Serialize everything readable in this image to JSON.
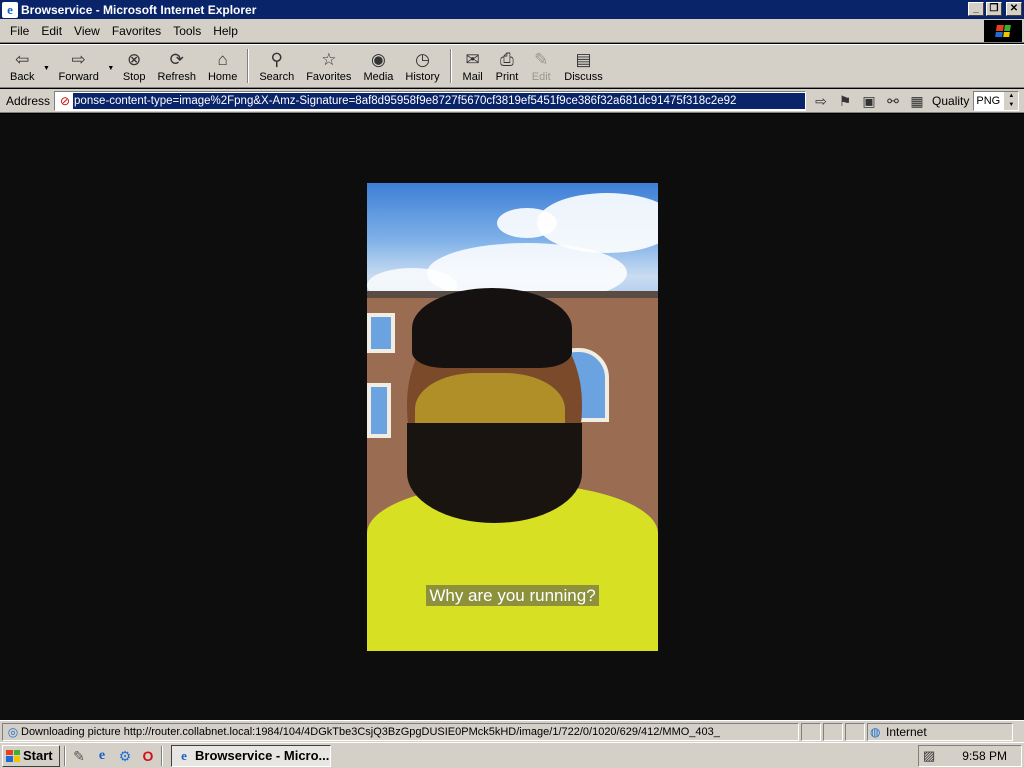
{
  "window": {
    "title": "Browservice - Microsoft Internet Explorer",
    "icon": "ie-icon",
    "controls": [
      "minimize",
      "restore",
      "close"
    ]
  },
  "menu": {
    "items": [
      "File",
      "Edit",
      "View",
      "Favorites",
      "Tools",
      "Help"
    ]
  },
  "toolbar": {
    "back": "Back",
    "forward": "Forward",
    "stop": "Stop",
    "refresh": "Refresh",
    "home": "Home",
    "search": "Search",
    "favorites": "Favorites",
    "media": "Media",
    "history": "History",
    "mail": "Mail",
    "print": "Print",
    "edit": "Edit",
    "discuss": "Discuss"
  },
  "address": {
    "label": "Address",
    "value": "ponse-content-type=image%2Fpng&X-Amz-Signature=8af8d95958f9e8727f5670cf3819ef5451f9ce386f32a681dc91475f318c2e92",
    "quality_label": "Quality",
    "quality_value": "PNG"
  },
  "content": {
    "subtitle": "Why are you running?"
  },
  "status": {
    "text": "Downloading picture http://router.collabnet.local:1984/104/4DGkTbe3CsjQ3BzGpgDUSIE0PMck5kHD/image/1/722/0/1020/629/412/MMO_403_",
    "zone": "Internet"
  },
  "taskbar": {
    "start": "Start",
    "task": "Browservice - Micro...",
    "clock": "9:58 PM"
  },
  "colors": {
    "titlebar": "#0a246a",
    "chrome": "#d4d0c8",
    "viewport": "#0d0d0d",
    "address_highlight": "#0a246a"
  }
}
